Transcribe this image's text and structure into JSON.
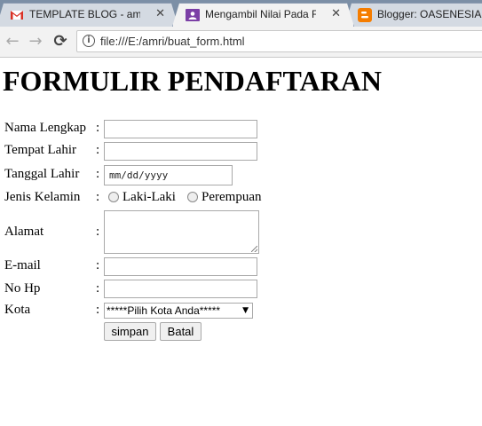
{
  "browser": {
    "tabs": [
      {
        "title": "TEMPLATE BLOG - amri.y",
        "icon": "gmail-icon",
        "active": false
      },
      {
        "title": "Mengambil Nilai Pada Fo",
        "icon": "classroom-icon",
        "active": true
      },
      {
        "title": "Blogger: OASENESIA -",
        "icon": "blogger-icon",
        "active": false
      }
    ],
    "close_glyph": "✕",
    "back_glyph": "←",
    "forward_glyph": "→",
    "reload_glyph": "⟳",
    "info_glyph": "i",
    "url": "file:///E:/amri/buat_form.html"
  },
  "page": {
    "heading": "FORMULIR PENDAFTARAN",
    "colon": ":",
    "fields": {
      "nama": "Nama Lengkap",
      "tempat": "Tempat Lahir",
      "tanggal": "Tanggal Lahir",
      "jenis": "Jenis Kelamin",
      "alamat": "Alamat",
      "email": "E-mail",
      "hp": "No Hp",
      "kota": "Kota"
    },
    "date_placeholder": "mm/dd/yyyy",
    "gender_options": [
      "Laki-Laki",
      "Perempuan"
    ],
    "kota_selected": "*****Pilih Kota Anda*****",
    "select_arrow": "▼",
    "buttons": {
      "simpan": "simpan",
      "batal": "Batal"
    }
  },
  "colors": {
    "gmail_red": "#d93025",
    "classroom_purple": "#7b3fa6",
    "blogger_orange": "#f57d00",
    "tabstrip": "#7c8fa6"
  }
}
